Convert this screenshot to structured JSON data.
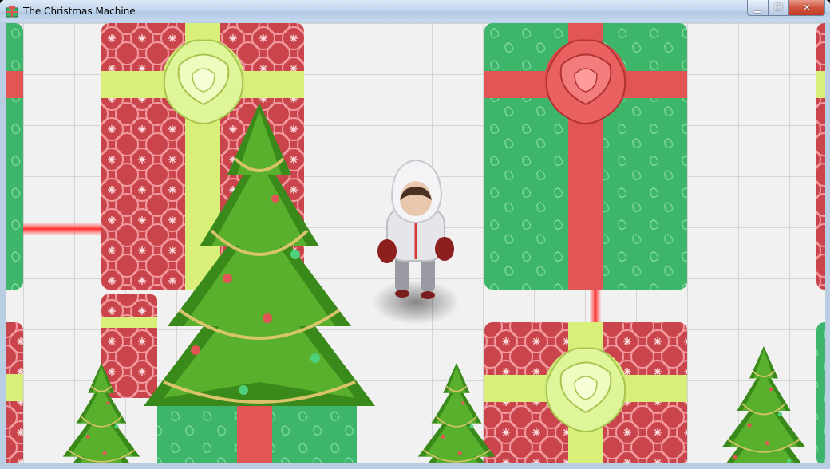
{
  "window": {
    "title": "The Christmas Machine",
    "controls": {
      "minimize": "▁",
      "maximize": "❐",
      "close": "✕"
    }
  },
  "scene": {
    "floor_color": "#f1f1f1",
    "grid_color": "#d6d6d6",
    "colors": {
      "present_red": "#cc4a4e",
      "present_green": "#3fb46a",
      "ribbon_lime": "#d8f07a",
      "ribbon_red": "#e25555",
      "tree_green": "#3f8f1c",
      "garland_gold": "#d9c86a",
      "laser_red": "#ff4a4a"
    },
    "player": {
      "name": "player-character"
    }
  }
}
